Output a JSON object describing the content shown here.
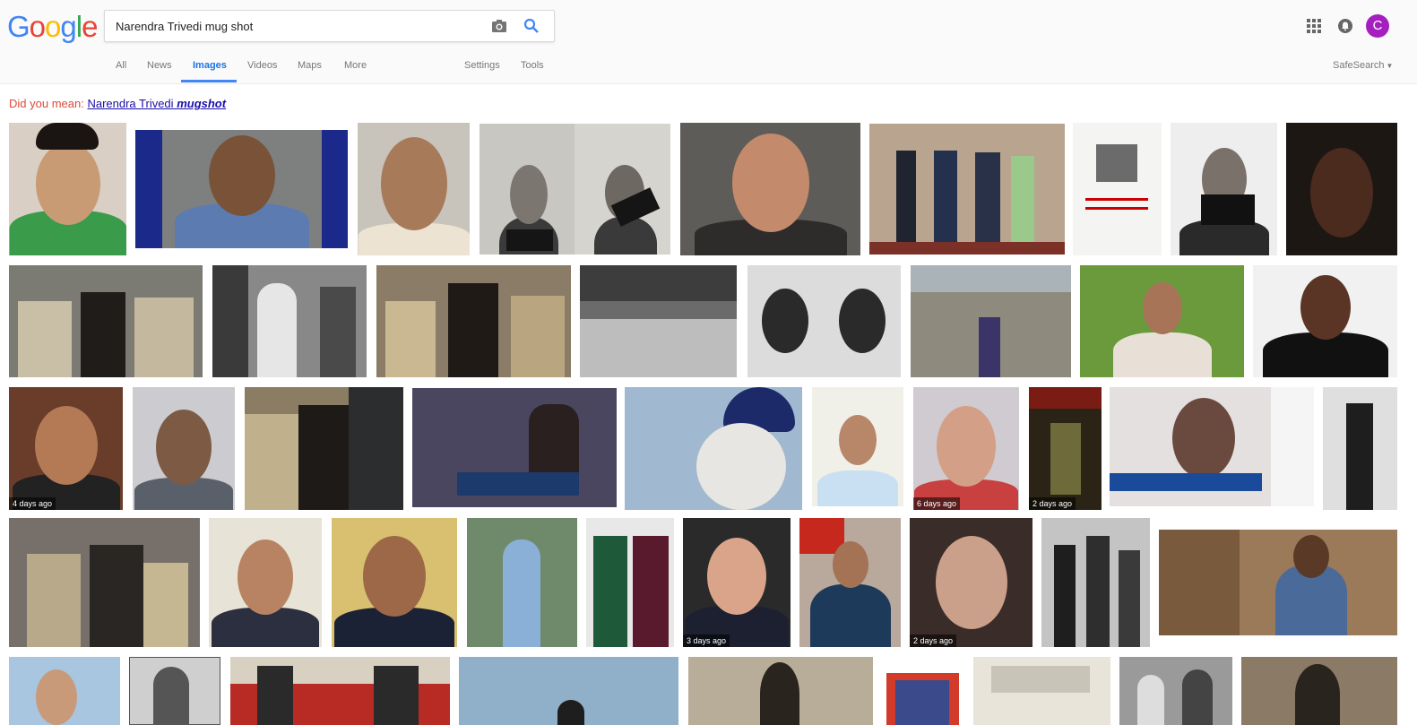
{
  "header": {
    "logo_letters": [
      {
        "ch": "G",
        "color": "#4285f4"
      },
      {
        "ch": "o",
        "color": "#ea4335"
      },
      {
        "ch": "o",
        "color": "#fbbc05"
      },
      {
        "ch": "g",
        "color": "#4285f4"
      },
      {
        "ch": "l",
        "color": "#34a853"
      },
      {
        "ch": "e",
        "color": "#ea4335"
      }
    ],
    "query": "Narendra Trivedi mug shot",
    "camera_icon": "camera-icon",
    "search_icon": "search-icon",
    "apps_icon": "apps-grid-icon",
    "notifications_icon": "notifications-icon",
    "avatar_letter": "C"
  },
  "nav": {
    "tabs": [
      {
        "label": "All"
      },
      {
        "label": "News"
      },
      {
        "label": "Images"
      },
      {
        "label": "Videos"
      },
      {
        "label": "Maps"
      },
      {
        "label": "More"
      }
    ],
    "settings": "Settings",
    "tools": "Tools",
    "safesearch": "SafeSearch"
  },
  "suggestion": {
    "prefix": "Did you mean:",
    "normal": "Narendra Trivedi",
    "bold": "mugshot"
  },
  "results": {
    "badges": [
      "4 days ago",
      "6 days ago",
      "2 days ago",
      "3 days ago",
      "2 days ago"
    ]
  },
  "colors": {
    "accent": "#4285f4",
    "link": "#1a0dab",
    "suggest": "#dd4b39"
  }
}
